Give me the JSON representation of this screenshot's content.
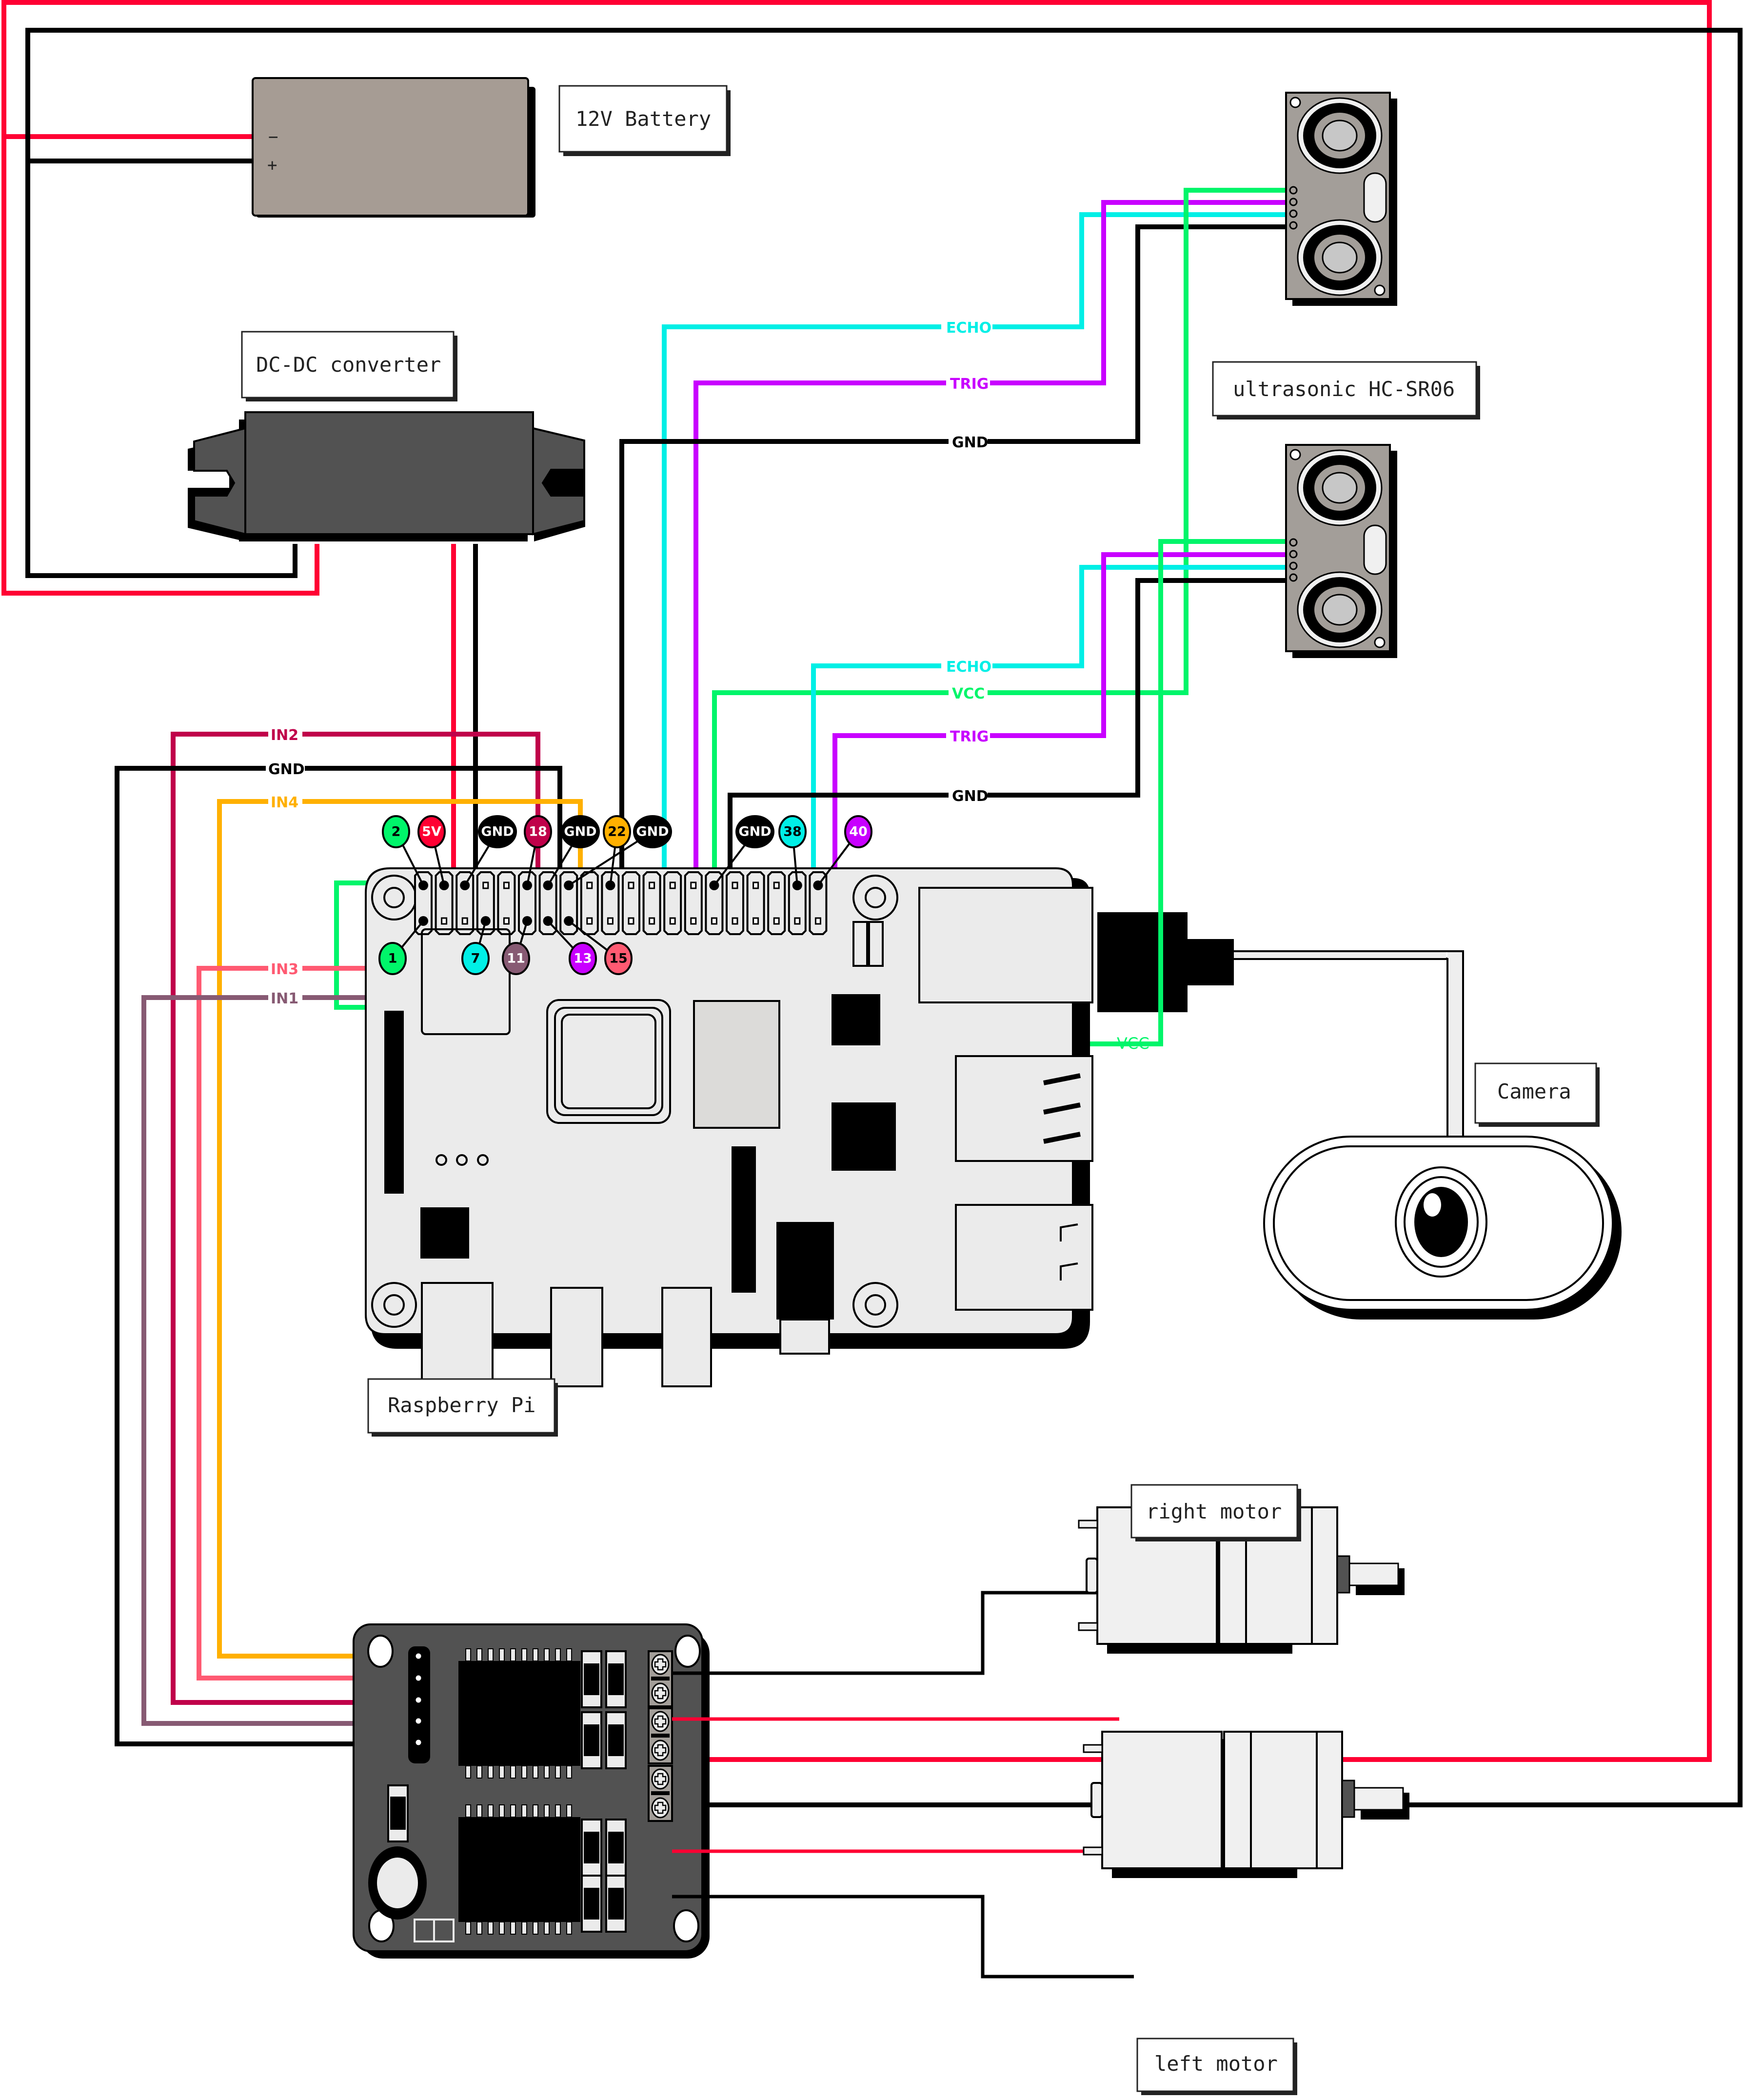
{
  "colors": {
    "red": "#ff0033",
    "black": "#000000",
    "green": "#00f56a",
    "cyan": "#00efe6",
    "purple": "#c800ff",
    "orange": "#ffb000",
    "crimson": "#c0004a",
    "pink": "#ff5a72",
    "mauve": "#875a73",
    "battery": "#a69c94",
    "converter": "#525252",
    "sensor": "#a39e99",
    "board": "#ebebeb",
    "driver": "#525252"
  },
  "components": {
    "battery": {
      "label": "12V Battery",
      "terminal_minus": "−",
      "terminal_plus": "+"
    },
    "converter": {
      "label": "DC-DC converter"
    },
    "ultrasonic": {
      "label": "ultrasonic HC-SR06"
    },
    "raspberry_pi": {
      "label": "Raspberry Pi"
    },
    "camera": {
      "label": "Camera"
    },
    "right_motor": {
      "label": "right motor"
    },
    "left_motor": {
      "label": "left motor"
    }
  },
  "gpio_pins": {
    "top": [
      {
        "label": "2",
        "color": "green",
        "text": "#000"
      },
      {
        "label": "5V",
        "color": "red",
        "text": "#fff"
      },
      {
        "label": "GND",
        "color": "black",
        "text": "#fff"
      },
      {
        "label": "18",
        "color": "crimson",
        "text": "#fff"
      },
      {
        "label": "GND",
        "color": "black",
        "text": "#fff"
      },
      {
        "label": "22",
        "color": "orange",
        "text": "#000"
      },
      {
        "label": "GND",
        "color": "black",
        "text": "#fff"
      },
      {
        "label": "GND",
        "color": "black",
        "text": "#fff"
      },
      {
        "label": "38",
        "color": "cyan",
        "text": "#000"
      },
      {
        "label": "40",
        "color": "purple",
        "text": "#fff"
      }
    ],
    "bottom": [
      {
        "label": "1",
        "color": "green",
        "text": "#000"
      },
      {
        "label": "7",
        "color": "cyan",
        "text": "#000"
      },
      {
        "label": "11",
        "color": "mauve",
        "text": "#fff"
      },
      {
        "label": "13",
        "color": "purple",
        "text": "#fff"
      },
      {
        "label": "15",
        "color": "pink",
        "text": "#000"
      }
    ]
  },
  "wire_labels": {
    "sensor1": {
      "echo": "ECHO",
      "trig": "TRIG",
      "gnd": "GND"
    },
    "sensor2": {
      "echo": "ECHO",
      "vcc": "VCC",
      "trig": "TRIG",
      "gnd": "GND"
    },
    "driver": {
      "in2": "IN2",
      "gnd": "GND",
      "in4": "IN4",
      "in3": "IN3",
      "in1": "IN1"
    },
    "camera_vcc": "VCC"
  }
}
